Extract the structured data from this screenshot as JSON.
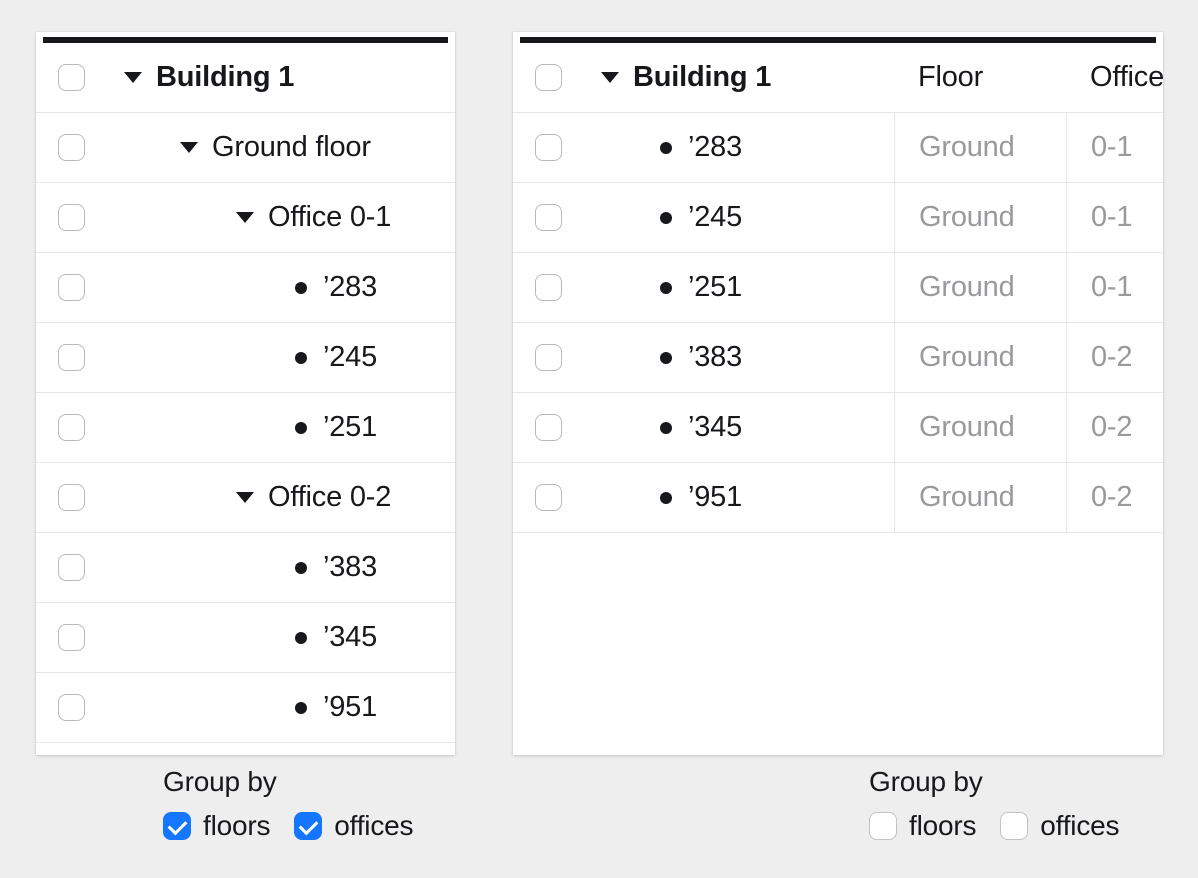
{
  "background_color": "#eeeeee",
  "accent_color": "#1577ff",
  "muted_text_color": "#9a9a9e",
  "left_panel": {
    "name": "grouped-tree-panel",
    "top_rule_color": "#17181c",
    "rows": [
      {
        "level": 0,
        "marker": "caret-down",
        "label": "Building 1",
        "bold": true,
        "checked": false
      },
      {
        "level": 1,
        "marker": "caret-down",
        "label": "Ground floor",
        "bold": false,
        "checked": false
      },
      {
        "level": 2,
        "marker": "caret-down",
        "label": "Office 0-1",
        "bold": false,
        "checked": false
      },
      {
        "level": 3,
        "marker": "bullet",
        "label": "’283",
        "bold": false,
        "checked": false
      },
      {
        "level": 3,
        "marker": "bullet",
        "label": "’245",
        "bold": false,
        "checked": false
      },
      {
        "level": 3,
        "marker": "bullet",
        "label": "’251",
        "bold": false,
        "checked": false
      },
      {
        "level": 2,
        "marker": "caret-down",
        "label": "Office 0-2",
        "bold": false,
        "checked": false
      },
      {
        "level": 3,
        "marker": "bullet",
        "label": "’383",
        "bold": false,
        "checked": false
      },
      {
        "level": 3,
        "marker": "bullet",
        "label": "’345",
        "bold": false,
        "checked": false
      },
      {
        "level": 3,
        "marker": "bullet",
        "label": "’951",
        "bold": false,
        "checked": false
      }
    ],
    "group_by": {
      "title": "Group by",
      "options": [
        {
          "label": "floors",
          "checked": true
        },
        {
          "label": "offices",
          "checked": true
        }
      ]
    }
  },
  "right_panel": {
    "name": "flat-table-panel",
    "top_rule_color": "#17181c",
    "columns": [
      "Building 1",
      "Floor",
      "Office"
    ],
    "header": {
      "marker": "caret-down",
      "title": "Building 1",
      "col_floor": "Floor",
      "col_office": "Office",
      "checked": false
    },
    "rows": [
      {
        "marker": "bullet",
        "label": "’283",
        "floor": "Ground",
        "office": "0-1",
        "checked": false
      },
      {
        "marker": "bullet",
        "label": "’245",
        "floor": "Ground",
        "office": "0-1",
        "checked": false
      },
      {
        "marker": "bullet",
        "label": "’251",
        "floor": "Ground",
        "office": "0-1",
        "checked": false
      },
      {
        "marker": "bullet",
        "label": "’383",
        "floor": "Ground",
        "office": "0-2",
        "checked": false
      },
      {
        "marker": "bullet",
        "label": "’345",
        "floor": "Ground",
        "office": "0-2",
        "checked": false
      },
      {
        "marker": "bullet",
        "label": "’951",
        "floor": "Ground",
        "office": "0-2",
        "checked": false
      }
    ],
    "group_by": {
      "title": "Group by",
      "options": [
        {
          "label": "floors",
          "checked": false
        },
        {
          "label": "offices",
          "checked": false
        }
      ]
    }
  }
}
